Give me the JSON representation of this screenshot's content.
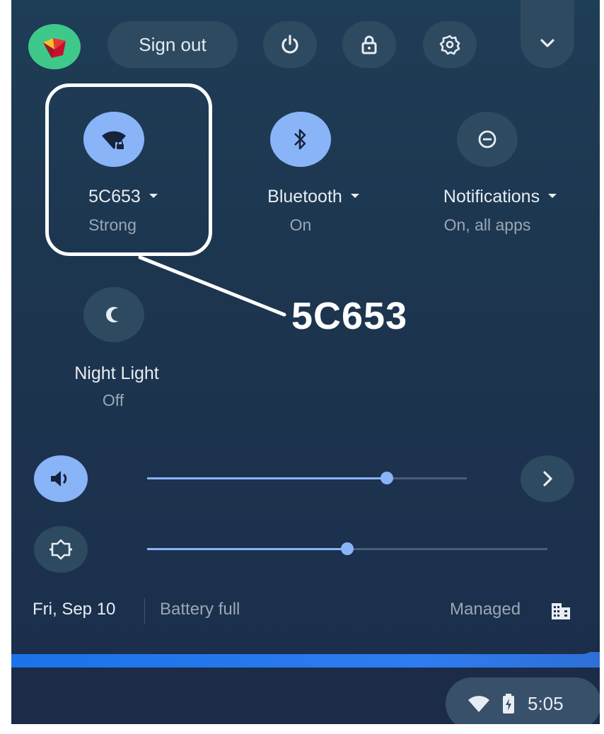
{
  "top_row": {
    "sign_out_label": "Sign out",
    "avatar_icon": "user-avatar-icon",
    "power_icon": "power-icon",
    "lock_icon": "lock-icon",
    "settings_icon": "gear-icon",
    "collapse_icon": "chevron-down-icon"
  },
  "pods": [
    {
      "label": "5C653",
      "sub": "Strong",
      "icon": "wifi-locked-icon",
      "state": "on"
    },
    {
      "label": "Bluetooth",
      "sub": "On",
      "icon": "bluetooth-icon",
      "state": "on"
    },
    {
      "label": "Notifications",
      "sub": "On, all apps",
      "icon": "do-not-disturb-icon",
      "state": "off"
    },
    {
      "label": "Night Light",
      "sub": "Off",
      "icon": "night-light-icon",
      "state": "off"
    }
  ],
  "callout": {
    "text": "5C653"
  },
  "sliders": {
    "volume": {
      "icon": "volume-icon",
      "level": 0.75
    },
    "brightness": {
      "icon": "brightness-icon",
      "level": 0.5
    },
    "next_icon": "chevron-right-icon"
  },
  "footer": {
    "date": "Fri, Sep 10",
    "battery": "Battery full",
    "managed": "Managed",
    "managed_icon": "enterprise-building-icon"
  },
  "tray": {
    "time": "5:05",
    "wifi_icon": "wifi-icon",
    "battery_icon": "battery-charging-icon"
  },
  "colors": {
    "panel": "#1d354f",
    "accent": "#8ab4f8",
    "button": "#2e4a60",
    "shelf_bar": "#1a73e8"
  }
}
